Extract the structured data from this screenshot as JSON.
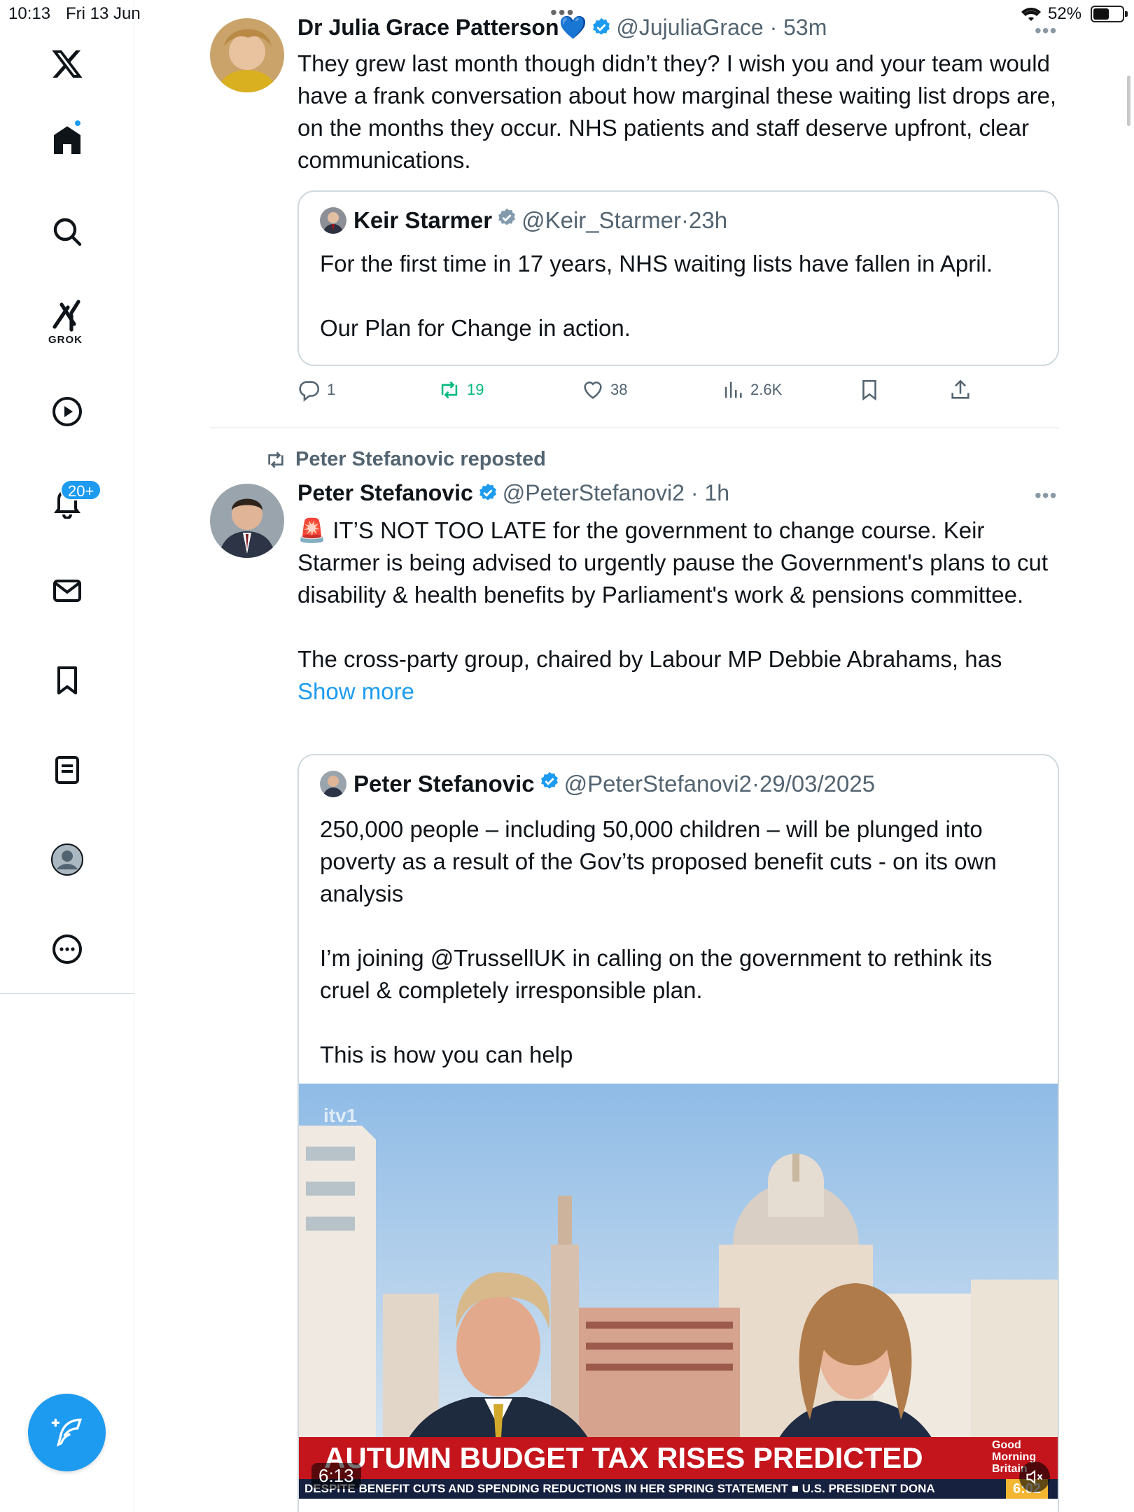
{
  "status_bar": {
    "time": "10:13",
    "date": "Fri 13 Jun",
    "battery": "52%"
  },
  "sidebar": {
    "grok_label": "GROK",
    "notifications_badge": "20+"
  },
  "tweets": [
    {
      "author_name": "Dr Julia Grace Patterson💙",
      "handle": "@JujuliaGrace",
      "age": "53m",
      "text": "They grew last month though didn’t they? I wish you and your team would have a frank conversation about how marginal these waiting list drops are, on the months they occur. NHS patients and staff deserve upfront, clear communications.",
      "quote": {
        "author_name": "Keir Starmer",
        "handle": "@Keir_Starmer",
        "age": "23h",
        "text": "For the first time in 17 years, NHS waiting lists have fallen in April.\n\nOur Plan for Change in action."
      },
      "actions": {
        "replies": "1",
        "reposts": "19",
        "likes": "38",
        "views": "2.6K"
      }
    },
    {
      "repost_label": "Peter Stefanovic reposted",
      "author_name": "Peter Stefanovic",
      "handle": "@PeterStefanovi2",
      "age": "1h",
      "text": "🚨 IT’S NOT TOO LATE for the government to change course. Keir Starmer is being advised to urgently pause the Government's plans to cut disability & health benefits by Parliament's work & pensions committee.\n\nThe cross-party group, chaired by Labour MP Debbie Abrahams, has ",
      "show_more": "Show more",
      "quote": {
        "author_name": "Peter Stefanovic",
        "handle": "@PeterStefanovi2",
        "age": "29/03/2025",
        "text": "250,000 people – including 50,000 children – will be plunged into poverty as a result of the Gov’ts proposed benefit cuts - on its own analysis\n\nI’m joining @TrussellUK in calling on the government to rethink its cruel & completely irresponsible plan.\n\nThis is how you can help",
        "video": {
          "duration": "6:13",
          "watermark": "itv1",
          "banner": "AUTUMN BUDGET TAX RISES PREDICTED",
          "ticker": "DESPITE BENEFIT CUTS AND SPENDING REDUCTIONS IN HER SPRING STATEMENT     ■     U.S. PRESIDENT DONA",
          "show_logo": "Good\nMorning\nBritain",
          "clock": "6:02"
        }
      }
    }
  ]
}
